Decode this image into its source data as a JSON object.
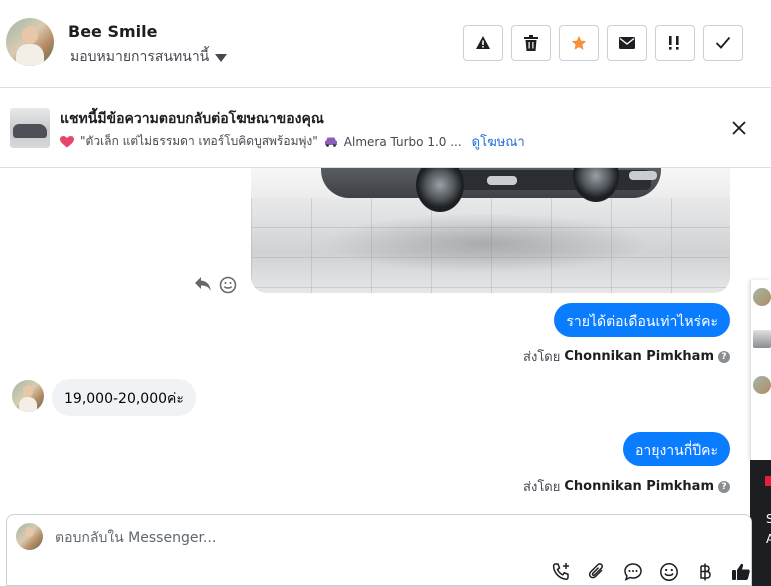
{
  "header": {
    "contact_name": "Bee Smile",
    "assign_label": "มอบหมายการสนทนานี้",
    "toolbar": [
      {
        "name": "report-button",
        "icon": "warning-icon"
      },
      {
        "name": "delete-button",
        "icon": "trash-icon"
      },
      {
        "name": "star-button",
        "icon": "star-icon"
      },
      {
        "name": "mark-unread-button",
        "icon": "envelope-icon"
      },
      {
        "name": "follow-up-button",
        "icon": "exclamation-icon"
      },
      {
        "name": "mark-done-button",
        "icon": "check-icon"
      }
    ],
    "star_color": "#f7923b"
  },
  "ad_banner": {
    "title": "แชทนี้มีข้อความตอบกลับต่อโฆษณาของคุณ",
    "ad_text": "\"ตัวเล็ก แต่ไม่ธรรมดา เทอร์โบคิดบูสพร้อมพุ่ง\"",
    "car_text": "Almera Turbo 1.0 ...",
    "link_label": "ดูโฆษณา"
  },
  "messages": [
    {
      "direction": "out",
      "text": "รายได้ต่อเดือนเท่าไหร่คะ",
      "sent_by_prefix": "ส่งโดย",
      "sent_by_name": "Chonnikan Pimkham"
    },
    {
      "direction": "in",
      "text": "19,000-20,000ค่ะ"
    },
    {
      "direction": "out",
      "text": "อายุงานกี่ปีคะ",
      "sent_by_prefix": "ส่งโดย",
      "sent_by_name": "Chonnikan Pimkham"
    }
  ],
  "composer": {
    "placeholder": "ตอบกลับใน Messenger...",
    "tools": [
      "phone-plus-icon",
      "paperclip-icon",
      "chat-bubble-icon",
      "smiley-icon",
      "baht-icon",
      "thumbs-up-icon"
    ]
  },
  "side_peek": {
    "letter1": "S",
    "letter2": "A"
  },
  "colors": {
    "outgoing_bubble": "#0a7cff",
    "incoming_bubble": "#f0f2f5",
    "link": "#216fdb"
  }
}
